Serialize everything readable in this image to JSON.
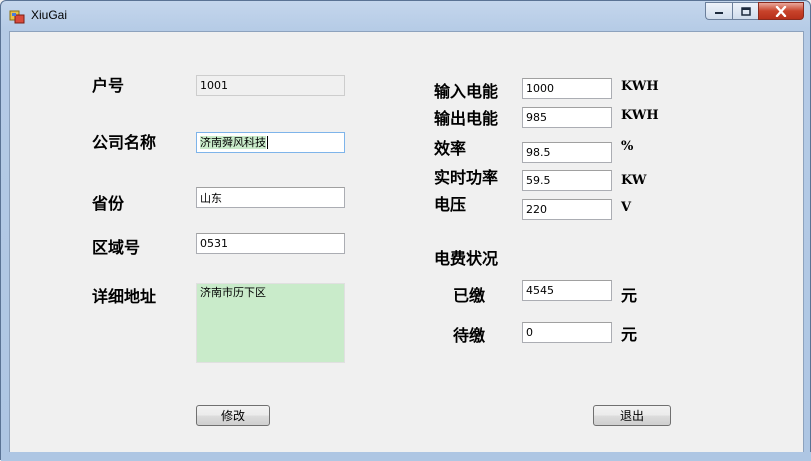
{
  "window": {
    "title": "XiuGai",
    "controls": {
      "minimize": "minimize",
      "maximize": "maximize",
      "close": "close"
    }
  },
  "left": {
    "account_no": {
      "label": "户号",
      "value": "1001"
    },
    "company": {
      "label": "公司名称",
      "value": "济南舜风科技"
    },
    "province": {
      "label": "省份",
      "value": "山东"
    },
    "area_code": {
      "label": "区域号",
      "value": "0531"
    },
    "address": {
      "label": "详细地址",
      "value": "济南市历下区"
    }
  },
  "right": {
    "input_power": {
      "label": "输入电能",
      "value": "1000",
      "unit": "KWH"
    },
    "output_power": {
      "label": "输出电能",
      "value": "985",
      "unit": "KWH"
    },
    "efficiency": {
      "label": "效率",
      "value": "98.5",
      "unit": "%"
    },
    "realtime": {
      "label": "实时功率",
      "value": "59.5",
      "unit": "KW"
    },
    "voltage": {
      "label": "电压",
      "value": "220",
      "unit": "V"
    },
    "fee_status": {
      "label": "电费状况"
    },
    "paid": {
      "label": "已缴",
      "value": "4545",
      "unit": "元"
    },
    "unpaid": {
      "label": "待缴",
      "value": "0",
      "unit": "元"
    }
  },
  "buttons": {
    "modify": "修改",
    "exit": "退出"
  },
  "colors": {
    "highlight": "#c9ebca",
    "frame": "#aec6e3",
    "close": "#c8432b"
  }
}
